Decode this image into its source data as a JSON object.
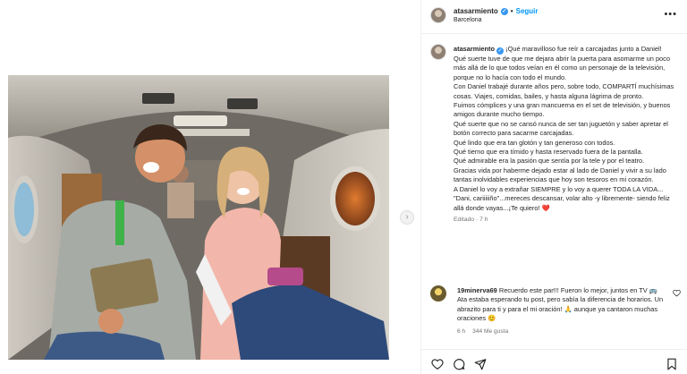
{
  "header": {
    "username": "atasarmiento",
    "follow_label": "Seguir",
    "separator": "•",
    "location": "Barcelona",
    "more_label": "•••"
  },
  "caption": {
    "username": "atasarmiento",
    "lines": [
      "¡Qué maravilloso fue reír a carcajadas junto a Daniel!",
      "Qué suerte tuve de que me dejara abrir la puerta para asomarme un poco más allá de lo que todos veían en él como un personaje de la televisión, porque no lo hacía con todo el mundo.",
      "Con Daniel trabajé durante años pero, sobre todo, COMPARTÍ muchísimas cosas. Viajes, comidas, bailes, y hasta alguna lágrima de pronto.",
      "Fuimos cómplices y una gran mancuerna en el set de televisión, y buenos amigos durante mucho tiempo.",
      "Qué suerte que no se cansó nunca de ser tan juguetón y saber apretar el botón correcto para sacarme carcajadas.",
      "Qué lindo que era tan glotón y tan generoso con todos.",
      "Qué tierno que era tímido y hasta reservado fuera de la pantalla.",
      "Qué admirable era la pasión que sentía por la tele y por el teatro.",
      "Gracias vida por haberme dejado estar al lado de Daniel y vivir a su lado tantas inolvidables experiencias que hoy son tesoros en mi corazón.",
      "A Daniel lo voy a extrañar SIEMPRE y lo voy a querer TODA LA VIDA...",
      "\"Dani, cariiiiiño\"...mereces descansar, volar alto -y libremente- siendo feliz allá donde vayas...¡Te quiero! ❤️"
    ],
    "meta": "Editado · 7 h"
  },
  "comment": {
    "username": "19minerva69",
    "text": "Recuerdo este par!!! Fueron lo mejor, juntos en TV 🚌 Ata estaba esperando tu post, pero sabía la diferencia de horarios. Un abrazito para ti y para el mi oración! 🙏 aunque ya cantaron muchas oraciones 😊",
    "time": "6 h",
    "likes": "344 Me gusta"
  },
  "actions": {
    "icons": [
      "heart-icon",
      "comment-icon",
      "share-icon",
      "bookmark-icon"
    ]
  },
  "colors": {
    "follow": "#0095f6",
    "verified": "#3897f0",
    "meta": "#737373"
  }
}
